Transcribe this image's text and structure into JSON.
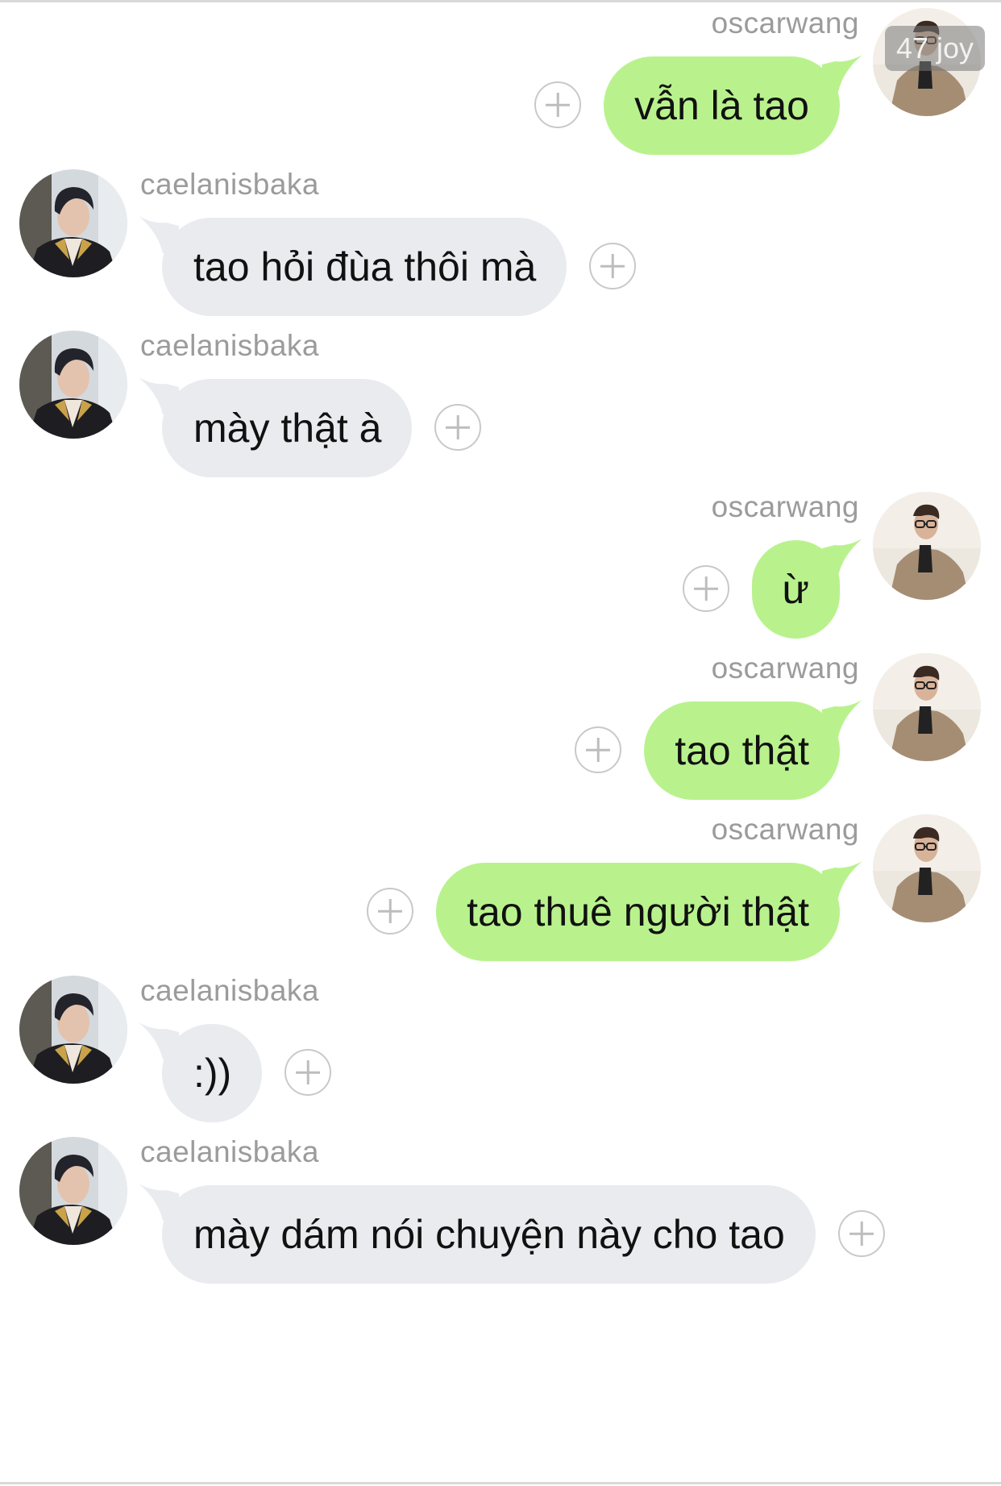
{
  "colors": {
    "outgoing_bubble": "#b9f28d",
    "incoming_bubble": "#e9ebef",
    "sender_name": "#9b9b9b",
    "message_text": "#111111",
    "plus_button": "#c9c9c9"
  },
  "watermark": "47 joy",
  "messages": [
    {
      "side": "right",
      "sender": "oscarwang",
      "text": "vẫn là tao"
    },
    {
      "side": "left",
      "sender": "caelanisbaka",
      "text": "tao hỏi đùa thôi mà"
    },
    {
      "side": "left",
      "sender": "caelanisbaka",
      "text": "mày thật à"
    },
    {
      "side": "right",
      "sender": "oscarwang",
      "text": "ừ"
    },
    {
      "side": "right",
      "sender": "oscarwang",
      "text": "tao thật"
    },
    {
      "side": "right",
      "sender": "oscarwang",
      "text": "tao thuê người thật"
    },
    {
      "side": "left",
      "sender": "caelanisbaka",
      "text": ":))"
    },
    {
      "side": "left",
      "sender": "caelanisbaka",
      "text": "mày dám nói chuyện này cho tao"
    }
  ]
}
